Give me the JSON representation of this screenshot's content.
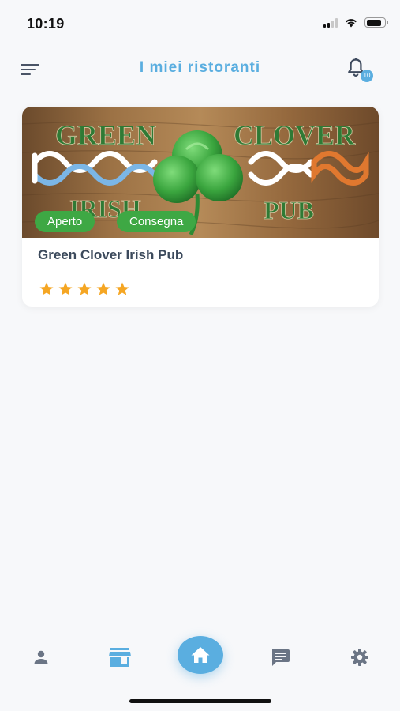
{
  "status_bar": {
    "time": "10:19"
  },
  "header": {
    "title": "I miei ristoranti",
    "notification_count": "10"
  },
  "restaurants": [
    {
      "name": "Green Clover Irish Pub",
      "tags": [
        "Aperto",
        "Consegna"
      ],
      "rating": 5,
      "max_rating": 5,
      "logo_text": {
        "top_left": "GREEN",
        "top_right": "CLOVER",
        "bottom_left": "IRISH",
        "bottom_right": "PUB"
      }
    }
  ],
  "colors": {
    "accent": "#5aaee0",
    "tag_green": "#3ea844",
    "star": "#f5a623",
    "icon_gray": "#6b7585"
  },
  "bottom_nav": [
    {
      "icon": "person-icon"
    },
    {
      "icon": "store-icon",
      "active": true
    },
    {
      "icon": "home-icon"
    },
    {
      "icon": "chat-icon"
    },
    {
      "icon": "gear-icon"
    }
  ]
}
